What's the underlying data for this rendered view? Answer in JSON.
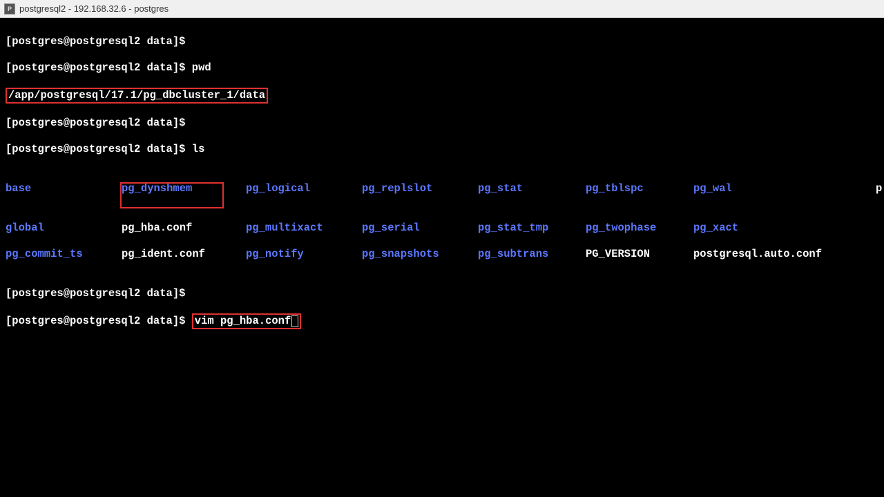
{
  "window_title": "postgresql2 - 192.168.32.6 - postgres",
  "prompt": "[postgres@postgresql2 data]$",
  "cmd_pwd": "pwd",
  "pwd_output": "/app/postgresql/17.1/pg_dbcluster_1/data",
  "cmd_ls": "ls",
  "cmd_vim": "vim pg_hba.conf",
  "ls": {
    "row1": [
      "base",
      "pg_dynshmem",
      "pg_logical",
      "pg_replslot",
      "pg_stat",
      "pg_tblspc",
      "pg_wal"
    ],
    "row2": [
      "global",
      "pg_hba.conf",
      "pg_multixact",
      "pg_serial",
      "pg_stat_tmp",
      "pg_twophase",
      "pg_xact"
    ],
    "row3": [
      "pg_commit_ts",
      "pg_ident.conf",
      "pg_notify",
      "pg_snapshots",
      "pg_subtrans",
      "PG_VERSION",
      "postgresql.auto.conf"
    ]
  },
  "partial_right": "p",
  "filetypes": {
    "base": "dir",
    "pg_dynshmem": "dir",
    "pg_logical": "dir",
    "pg_replslot": "dir",
    "pg_stat": "dir",
    "pg_tblspc": "dir",
    "pg_wal": "dir",
    "global": "dir",
    "pg_hba.conf": "file",
    "pg_multixact": "dir",
    "pg_serial": "dir",
    "pg_stat_tmp": "dir",
    "pg_twophase": "dir",
    "pg_xact": "dir",
    "pg_commit_ts": "dir",
    "pg_ident.conf": "file",
    "pg_notify": "dir",
    "pg_snapshots": "dir",
    "pg_subtrans": "dir",
    "PG_VERSION": "file",
    "postgresql.auto.conf": "file"
  }
}
